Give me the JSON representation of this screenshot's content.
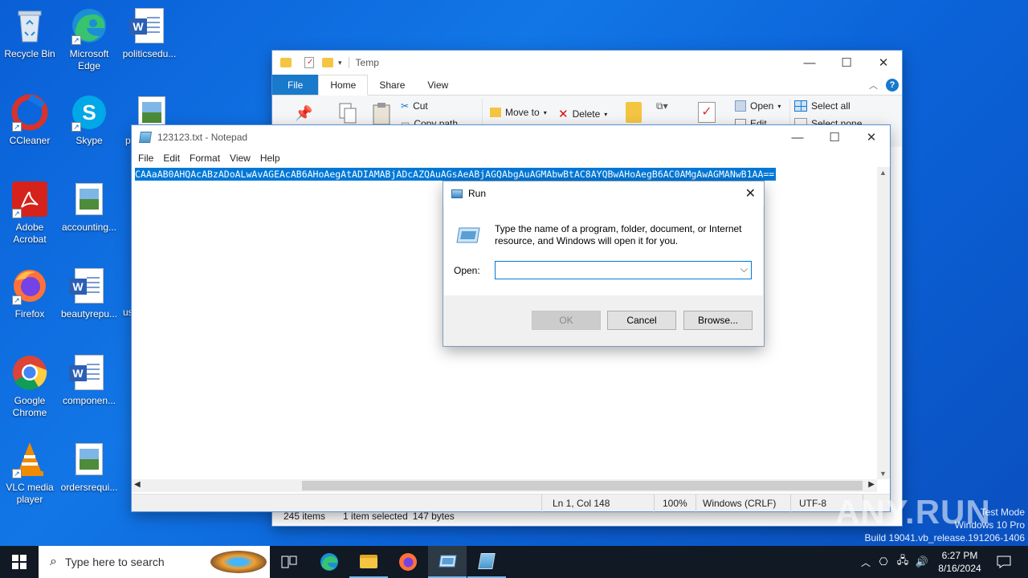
{
  "desktop": {
    "icons": [
      {
        "label": "Recycle Bin"
      },
      {
        "label": "Microsoft Edge"
      },
      {
        "label": "politicsedu..."
      },
      {
        "label": "CCleaner"
      },
      {
        "label": "Skype"
      },
      {
        "label": "p"
      },
      {
        "label": "Adobe Acrobat"
      },
      {
        "label": "accounting..."
      },
      {
        "label": "Firefox"
      },
      {
        "label": "beautyrepu..."
      },
      {
        "label": "us"
      },
      {
        "label": "Google Chrome"
      },
      {
        "label": "componen..."
      },
      {
        "label": "VLC media player"
      },
      {
        "label": "ordersrequi..."
      }
    ]
  },
  "explorer": {
    "title": "Temp",
    "tabs": [
      "File",
      "Home",
      "Share",
      "View"
    ],
    "ribbon": {
      "cut": "Cut",
      "copy_path": "Copy path",
      "move_to": "Move to",
      "delete": "Delete",
      "open": "Open",
      "edit": "Edit",
      "select_all": "Select all",
      "select_none": "Select none"
    },
    "status": {
      "items": "245 items",
      "selected": "1 item selected",
      "size": "147 bytes"
    }
  },
  "notepad": {
    "title": "123123.txt - Notepad",
    "menu": [
      "File",
      "Edit",
      "Format",
      "View",
      "Help"
    ],
    "content": "CAAaAB0AHQAcABzADoALwAvAGEAcAB6AHoAegAtADIAMABjADcAZQAuAGsAeABjAGQAbgAuAGMAbwBtAC8AYQBwAHoAegB6AC0AMgAwAGMANwB1AA==",
    "status": {
      "position": "Ln 1, Col 148",
      "zoom": "100%",
      "line_ending": "Windows (CRLF)",
      "encoding": "UTF-8"
    }
  },
  "run_dialog": {
    "title": "Run",
    "description": "Type the name of a program, folder, document, or Internet resource, and Windows will open it for you.",
    "open_label": "Open:",
    "open_value": "",
    "ok": "OK",
    "cancel": "Cancel",
    "browse": "Browse..."
  },
  "taskbar": {
    "search_placeholder": "Type here to search",
    "time": "6:27 PM",
    "date": "8/16/2024"
  },
  "watermark": {
    "brand": "ANY.RUN",
    "line1": "Test Mode",
    "line2": "Windows 10 Pro",
    "line3": "Build 19041.vb_release.191206-1406"
  }
}
